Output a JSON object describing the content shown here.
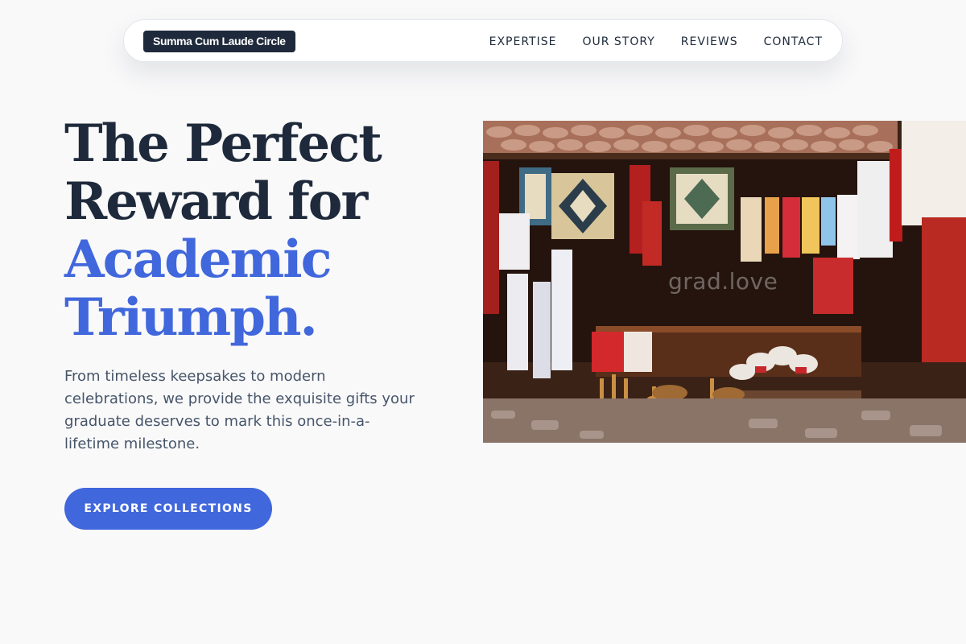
{
  "header": {
    "brand": "Summa Cum Laude Circle",
    "nav": [
      "EXPERTISE",
      "OUR STORY",
      "REVIEWS",
      "CONTACT"
    ]
  },
  "hero": {
    "title_line1": "The Perfect",
    "title_line2": "Reward for",
    "title_accent_line1": "Academic",
    "title_accent_line2": "Triumph.",
    "description": "From timeless keepsakes to modern celebrations, we provide the exquisite gifts your graduate deserves to mark this once-in-a-lifetime milestone.",
    "cta_label": "EXPLORE COLLECTIONS",
    "image_watermark": "grad.love"
  },
  "colors": {
    "navy": "#1e2a3b",
    "accent_blue": "#4167dc",
    "body_text": "#475569",
    "background": "#f9f9fa"
  }
}
